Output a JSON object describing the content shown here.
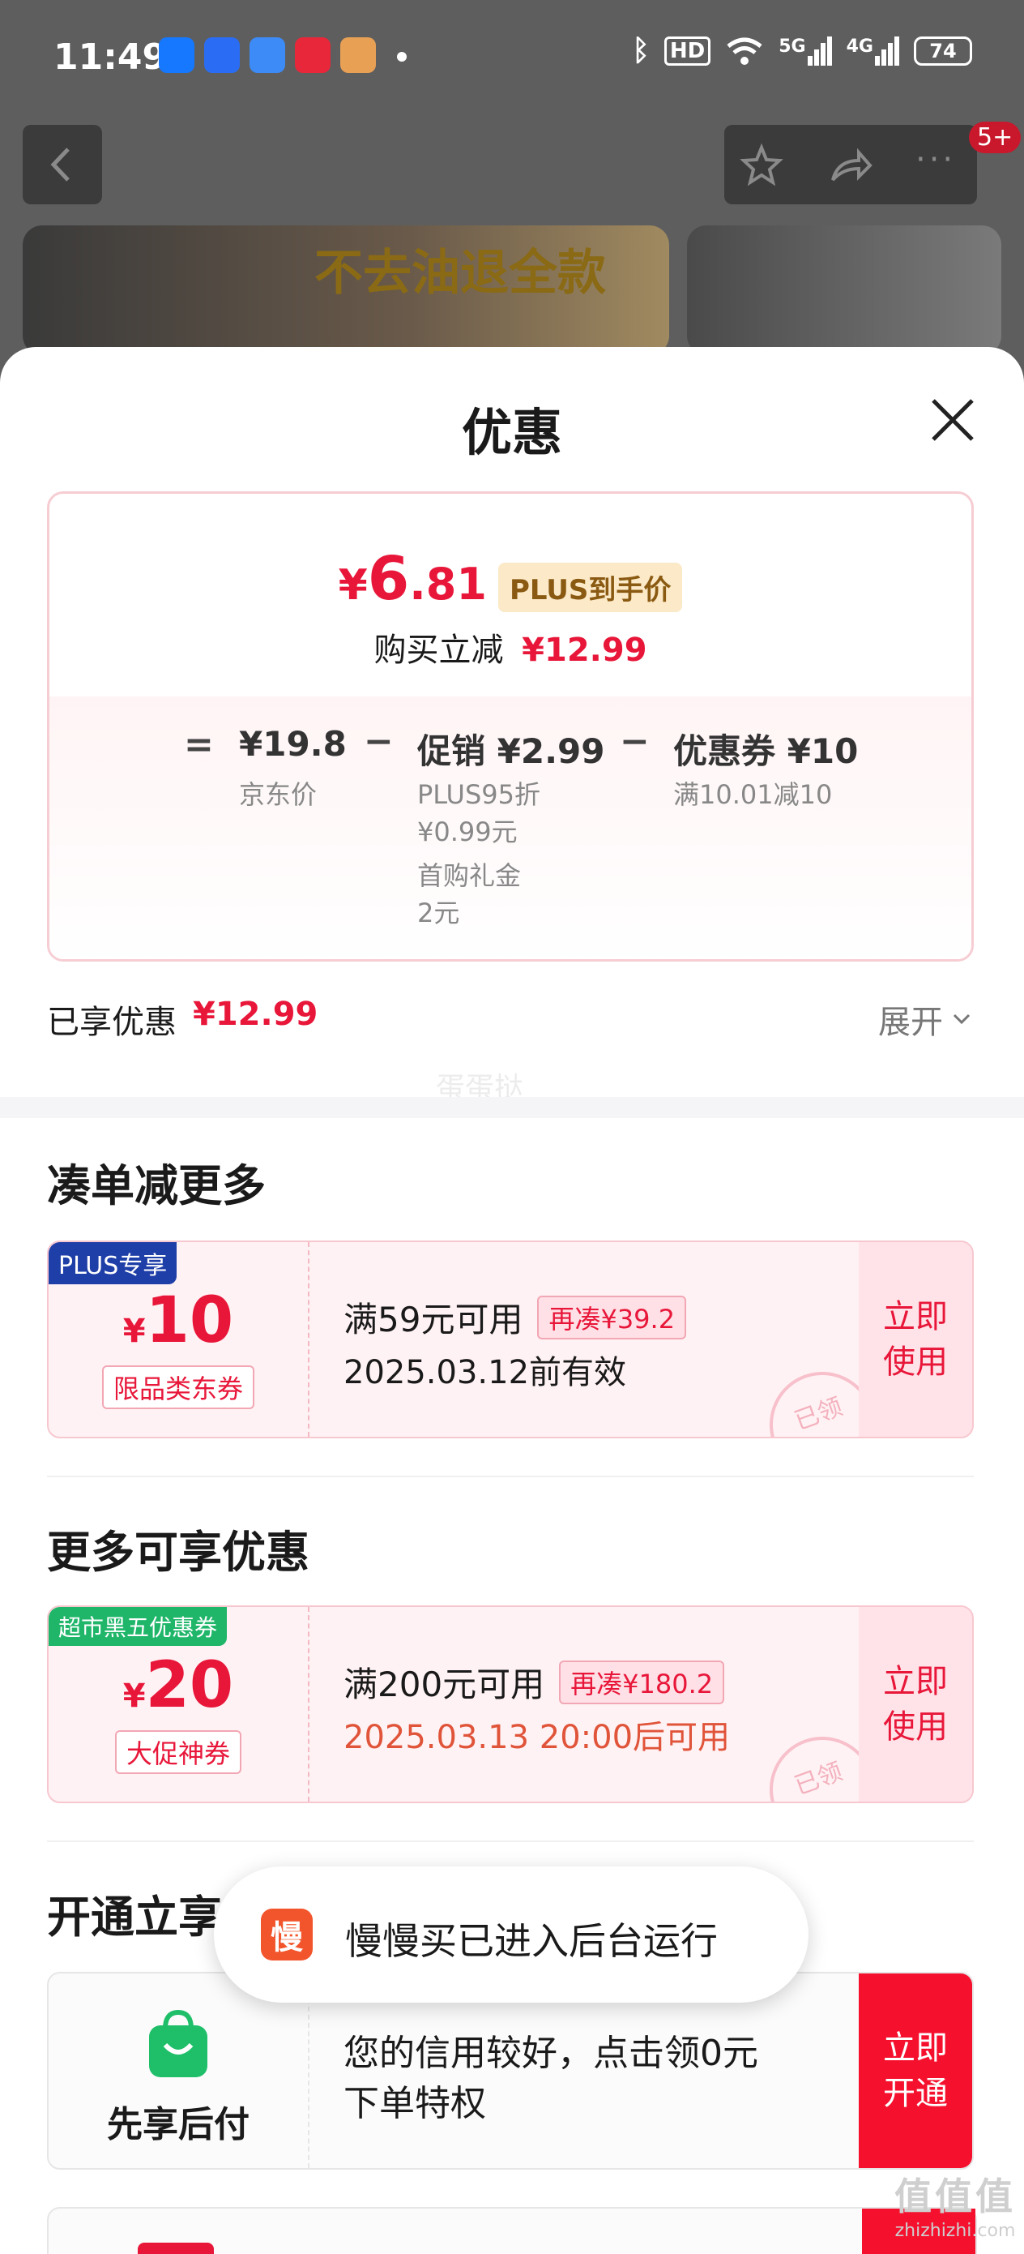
{
  "status_bar": {
    "time": "11:49",
    "hd": "HD",
    "net_5g": "5G",
    "net_4g": "4G",
    "battery": "74"
  },
  "nav": {
    "badge": "5+"
  },
  "banner": {
    "slogan": "不去油退全款"
  },
  "sheet": {
    "title": "优惠",
    "price_summary": {
      "currency": "¥",
      "final_price_int": "6",
      "final_price_dec": ".81",
      "plus_tag": "PLUS到手价",
      "instant_cut_label": "购买立减",
      "instant_cut_value": "¥12.99",
      "breakdown": {
        "eq": "=",
        "minus": "−",
        "jd_price": "¥19.8",
        "jd_price_label": "京东价",
        "promo": "促销 ¥2.99",
        "promo_detail1": "PLUS95折",
        "promo_detail1b": "¥0.99元",
        "promo_detail2": "首购礼金",
        "promo_detail2b": "2元",
        "coupon": "优惠券 ¥10",
        "coupon_detail": "满10.01减10"
      }
    },
    "enjoyed": {
      "label": "已享优惠",
      "value": "¥12.99",
      "expand": "展开"
    },
    "faint_watermark": "蛋蛋挞",
    "section_more": "凑单减更多",
    "coupon1": {
      "tag": "PLUS专享",
      "symbol": "¥",
      "amount": "10",
      "type": "限品类东券",
      "condition": "满59元可用",
      "chip": "再凑¥39.2",
      "validity": "2025.03.12前有效",
      "stamp": "已领",
      "action_line1": "立即",
      "action_line2": "使用"
    },
    "section_enjoy": "更多可享优惠",
    "coupon2": {
      "tag": "超市黑五优惠券",
      "symbol": "¥",
      "amount": "20",
      "type": "大促神券",
      "condition": "满200元可用",
      "chip": "再凑¥180.2",
      "validity": "2025.03.13 20:00后可用",
      "stamp": "已领",
      "action_line1": "立即",
      "action_line2": "使用"
    },
    "section_open": "开通立享",
    "credit": {
      "name": "先享后付",
      "line1": "您的信用较好，点击领0元",
      "line2": "下单特权",
      "action_line1": "立即",
      "action_line2": "开通"
    }
  },
  "toast": {
    "icon_char": "慢",
    "message": "慢慢买已进入后台运行"
  },
  "watermark": {
    "logo": "值值值",
    "site": "zhizhizhi.com"
  }
}
